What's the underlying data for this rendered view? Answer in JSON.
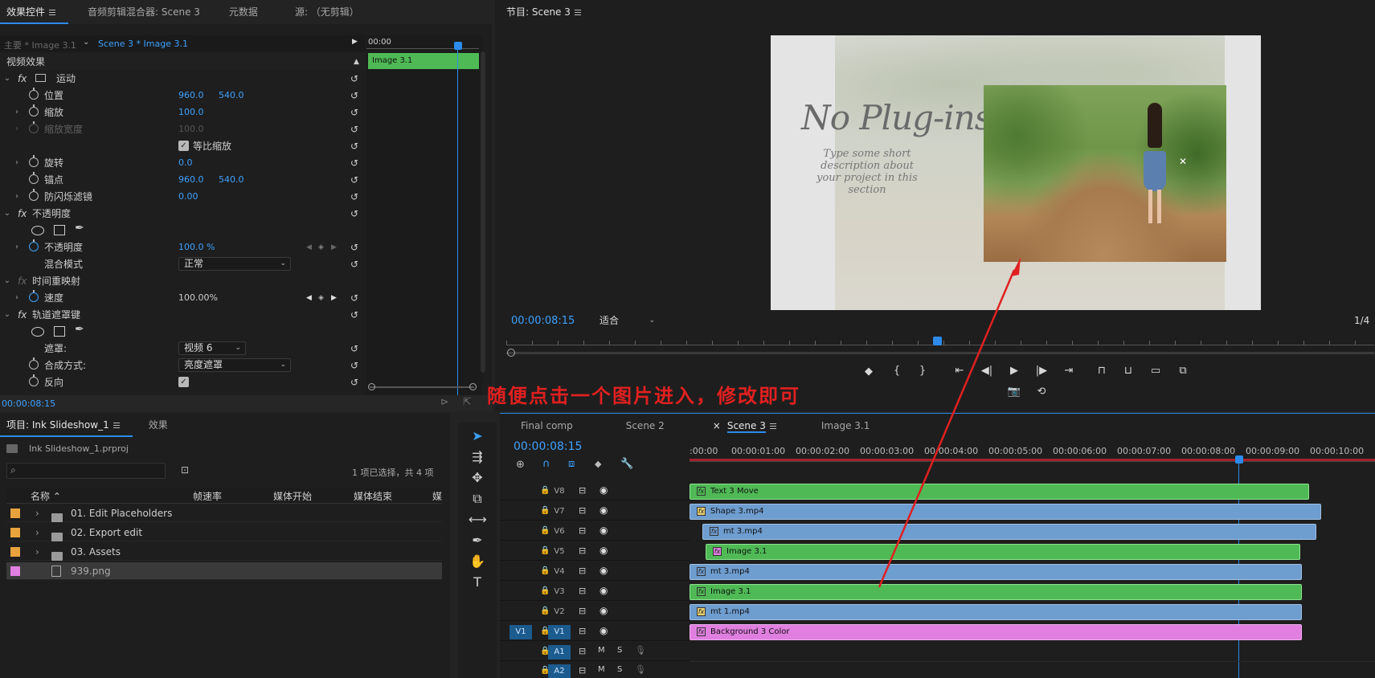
{
  "colors": {
    "accent": "#2d8ceb",
    "timecode": "#3da2ff",
    "annotation": "#e02020",
    "clip_green": "#4fba55",
    "clip_blue": "#6e9dcf",
    "clip_pink": "#e07fe0",
    "folder_swatch": "#e8a33d",
    "png_swatch": "#e07fe0"
  },
  "effects_panel": {
    "tabs": [
      "效果控件",
      "音频剪辑混合器: Scene 3",
      "元数据",
      "源: （无剪辑）"
    ],
    "master_clip": "主要 * Image 3.1",
    "seq_clip": "Scene 3 * Image 3.1",
    "timecode_head": "00:00",
    "clip_bar_label": "Image 3.1",
    "section_video": "视频效果",
    "motion": {
      "label": "运动",
      "position_label": "位置",
      "position_x": "960.0",
      "position_y": "540.0",
      "scale_label": "缩放",
      "scale_value": "100.0",
      "scale_width_label": "缩放宽度",
      "scale_width_value": "100.0",
      "uniform_label": "等比缩放",
      "rotation_label": "旋转",
      "rotation_value": "0.0",
      "anchor_label": "锚点",
      "anchor_x": "960.0",
      "anchor_y": "540.0",
      "flicker_label": "防闪烁滤镜",
      "flicker_value": "0.00"
    },
    "opacity": {
      "label": "不透明度",
      "opacity_label": "不透明度",
      "opacity_value": "100.0 %",
      "blend_label": "混合模式",
      "blend_value": "正常"
    },
    "time_remap": {
      "label": "时间重映射",
      "speed_label": "速度",
      "speed_value": "100.00%"
    },
    "track_matte": {
      "label": "轨道遮罩键",
      "matte_label": "遮罩:",
      "matte_value": "视频 6",
      "composite_label": "合成方式:",
      "composite_value": "亮度遮罩",
      "reverse_label": "反向"
    },
    "footer_time": "00:00:08:15"
  },
  "program": {
    "title": "节目: Scene 3",
    "timecode": "00:00:08:15",
    "fit": "适合",
    "quality": "1/4",
    "preview_title": "No Plug-ins",
    "preview_desc": "Type some short description about your project in this section"
  },
  "annotation": "随便点击一个图片进入，修改即可",
  "project": {
    "tabs": [
      "项目: Ink Slideshow_1",
      "效果"
    ],
    "file": "Ink Slideshow_1.prproj",
    "selection": "1 项已选择，共 4 项",
    "columns": [
      "名称",
      "帧速率",
      "媒体开始",
      "媒体结束",
      "媒"
    ],
    "items": [
      {
        "name": "01. Edit Placeholders",
        "type": "folder"
      },
      {
        "name": "02. Export edit",
        "type": "folder"
      },
      {
        "name": "03. Assets",
        "type": "folder"
      },
      {
        "name": "939.png",
        "type": "file"
      }
    ]
  },
  "timeline": {
    "tabs": [
      "Final comp",
      "Scene 2",
      "Scene 3",
      "Image 3.1"
    ],
    "timecode": "00:00:08:15",
    "ruler": [
      ":00:00",
      "00:00:01:00",
      "00:00:02:00",
      "00:00:03:00",
      "00:00:04:00",
      "00:00:05:00",
      "00:00:06:00",
      "00:00:07:00",
      "00:00:08:00",
      "00:00:09:00",
      "00:00:10:00"
    ],
    "tracks": [
      {
        "name": "V8",
        "clip": "Text 3 Move",
        "color": "green"
      },
      {
        "name": "V7",
        "clip": "Shape 3.mp4",
        "color": "blue"
      },
      {
        "name": "V6",
        "clip": "mt 3.mp4",
        "color": "blue"
      },
      {
        "name": "V5",
        "clip": "Image 3.1",
        "color": "green"
      },
      {
        "name": "V4",
        "clip": "mt 3.mp4",
        "color": "blue"
      },
      {
        "name": "V3",
        "clip": "Image 3.1",
        "color": "green"
      },
      {
        "name": "V2",
        "clip": "mt 1.mp4",
        "color": "blue"
      },
      {
        "name": "V1",
        "clip": "Background 3 Color",
        "color": "pink"
      }
    ],
    "audio": [
      "A1",
      "A2"
    ],
    "v1_source": "V1",
    "mute": "M",
    "solo": "S"
  }
}
